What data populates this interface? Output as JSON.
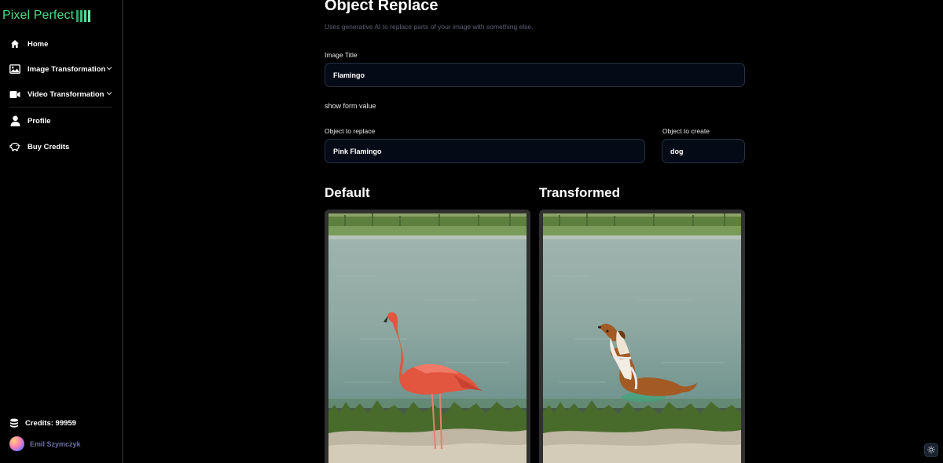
{
  "brand": {
    "name": "Pixel Perfect",
    "accent": "#4ade80"
  },
  "sidebar": {
    "items": [
      {
        "label": "Home",
        "icon": "home-icon"
      },
      {
        "label": "Image Transformation",
        "icon": "image-icon",
        "expandable": true
      },
      {
        "label": "Video Transformation",
        "icon": "video-icon",
        "expandable": true
      },
      {
        "label": "Profile",
        "icon": "user-icon"
      },
      {
        "label": "Buy Credits",
        "icon": "piggy-bank-icon"
      }
    ],
    "credits": "Credits: 99959",
    "user_name": "Emil Szymczyk"
  },
  "page": {
    "title": "Object Replace",
    "subtitle": "Uses generative AI to replace parts of your image with something else."
  },
  "form": {
    "image_title_label": "Image Title",
    "image_title_value": "Flamingo",
    "show_form_value": "show form value",
    "object_replace_label": "Object to replace",
    "object_replace_value": "Pink Flamingo",
    "object_create_label": "Object to create",
    "object_create_value": "dog"
  },
  "preview": {
    "default_title": "Default",
    "transformed_title": "Transformed"
  },
  "colors": {
    "background": "#000000",
    "field_bg": "#050a17",
    "field_border": "#283042",
    "frame": "#303030"
  }
}
